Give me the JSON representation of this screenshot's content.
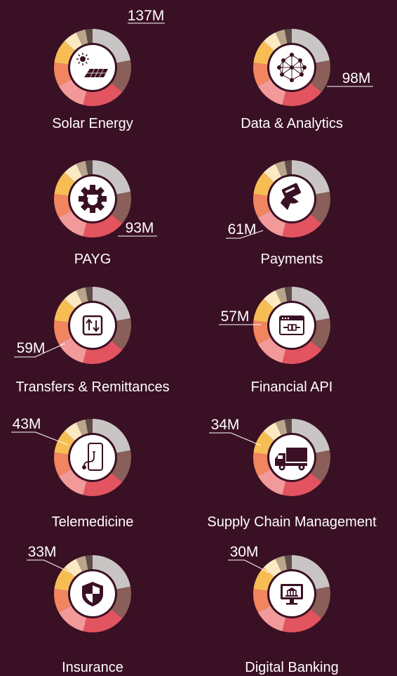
{
  "colors": {
    "background": "#3a1024",
    "ring_segments": [
      "#c9c5c5",
      "#8a5f59",
      "#e2545f",
      "#f29a9a",
      "#f0855f",
      "#f7bd55",
      "#fbe9c2",
      "#b9a58c",
      "#5e4c49"
    ],
    "center": "#ffffff",
    "icon": "#3a1024",
    "text": "#ffffff"
  },
  "chart_data": {
    "type": "donut",
    "ring_segment_share_percent": [
      22,
      14,
      18,
      13,
      10,
      10,
      6,
      4,
      3
    ],
    "items": [
      {
        "category": "Solar Energy",
        "value_label": "137M",
        "value_millions": 137,
        "icon": "solar-panel-icon"
      },
      {
        "category": "Data & Analytics",
        "value_label": "98M",
        "value_millions": 98,
        "icon": "network-cube-icon"
      },
      {
        "category": "PAYG",
        "value_label": "93M",
        "value_millions": 93,
        "icon": "gear-icon"
      },
      {
        "category": "Payments",
        "value_label": "61M",
        "value_millions": 61,
        "icon": "card-hand-icon"
      },
      {
        "category": "Transfers & Remittances",
        "value_label": "59M",
        "value_millions": 59,
        "icon": "transfer-arrows-icon"
      },
      {
        "category": "Financial API",
        "value_label": "57M",
        "value_millions": 57,
        "icon": "api-window-icon"
      },
      {
        "category": "Telemedicine",
        "value_label": "43M",
        "value_millions": 43,
        "icon": "phone-stethoscope-icon"
      },
      {
        "category": "Supply Chain Management",
        "value_label": "34M",
        "value_millions": 34,
        "icon": "truck-icon"
      },
      {
        "category": "Insurance",
        "value_label": "33M",
        "value_millions": 33,
        "icon": "shield-icon"
      },
      {
        "category": "Digital Banking",
        "value_label": "30M",
        "value_millions": 30,
        "icon": "bank-monitor-icon"
      }
    ]
  }
}
